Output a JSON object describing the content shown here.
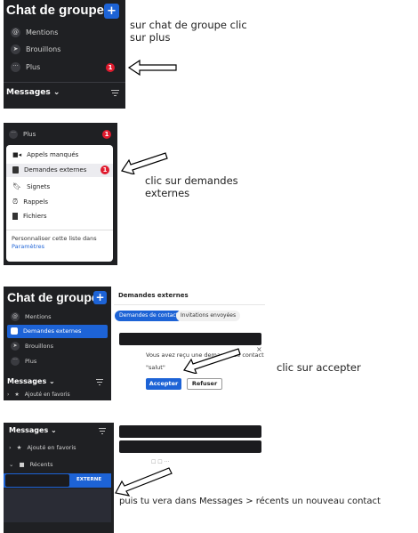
{
  "p1": {
    "title": "Chat de groupe",
    "plus": "+",
    "items": [
      {
        "icon": "at-icon",
        "label": "Mentions"
      },
      {
        "icon": "send-icon",
        "label": "Brouillons"
      },
      {
        "icon": "more-icon",
        "label": "Plus",
        "badge": "1"
      }
    ],
    "footer": "Messages ⌄",
    "note": "sur chat de groupe clic sur plus"
  },
  "p2": {
    "plus_label": "Plus",
    "plus_badge": "1",
    "menu": [
      {
        "icon": "video-icon",
        "label": "Appels manqués"
      },
      {
        "icon": "contact-icon",
        "label": "Demandes externes",
        "badge": "1",
        "selected": true
      },
      {
        "icon": "bookmark-icon",
        "label": "Signets"
      },
      {
        "icon": "reminder-icon",
        "label": "Rappels"
      },
      {
        "icon": "files-icon",
        "label": "Fichiers"
      }
    ],
    "customize_text": "Personnaliser cette liste dans",
    "customize_link": "Paramètres",
    "note": "clic sur demandes externes"
  },
  "p3": {
    "title": "Chat de groupe",
    "plus": "+",
    "items": [
      {
        "label": "Mentions"
      },
      {
        "label": "Demandes externes",
        "selected": true
      },
      {
        "label": "Brouillons"
      },
      {
        "label": "Plus"
      }
    ],
    "footer": "Messages ⌄",
    "favorites": "Ajouté en favoris",
    "panel_title": "Demandes externes",
    "tabs": [
      "Demandes de contact",
      "Invitations envoyées"
    ],
    "request_text": "Vous avez reçu une demande de contact",
    "request_msg": "\"salut\"",
    "close": "×",
    "accept": "Accepter",
    "refuse": "Refuser",
    "note": "clic sur accepter"
  },
  "p4": {
    "footer": "Messages ⌄",
    "favorites": "Ajouté en favoris",
    "recents": "Récents",
    "external_badge": "EXTERNE",
    "note": "puis tu vera dans Messages > récents un nouveau contact"
  },
  "colors": {
    "accent": "#1d63d6",
    "sidebar": "#1f2023",
    "badge": "#e01b2e"
  }
}
